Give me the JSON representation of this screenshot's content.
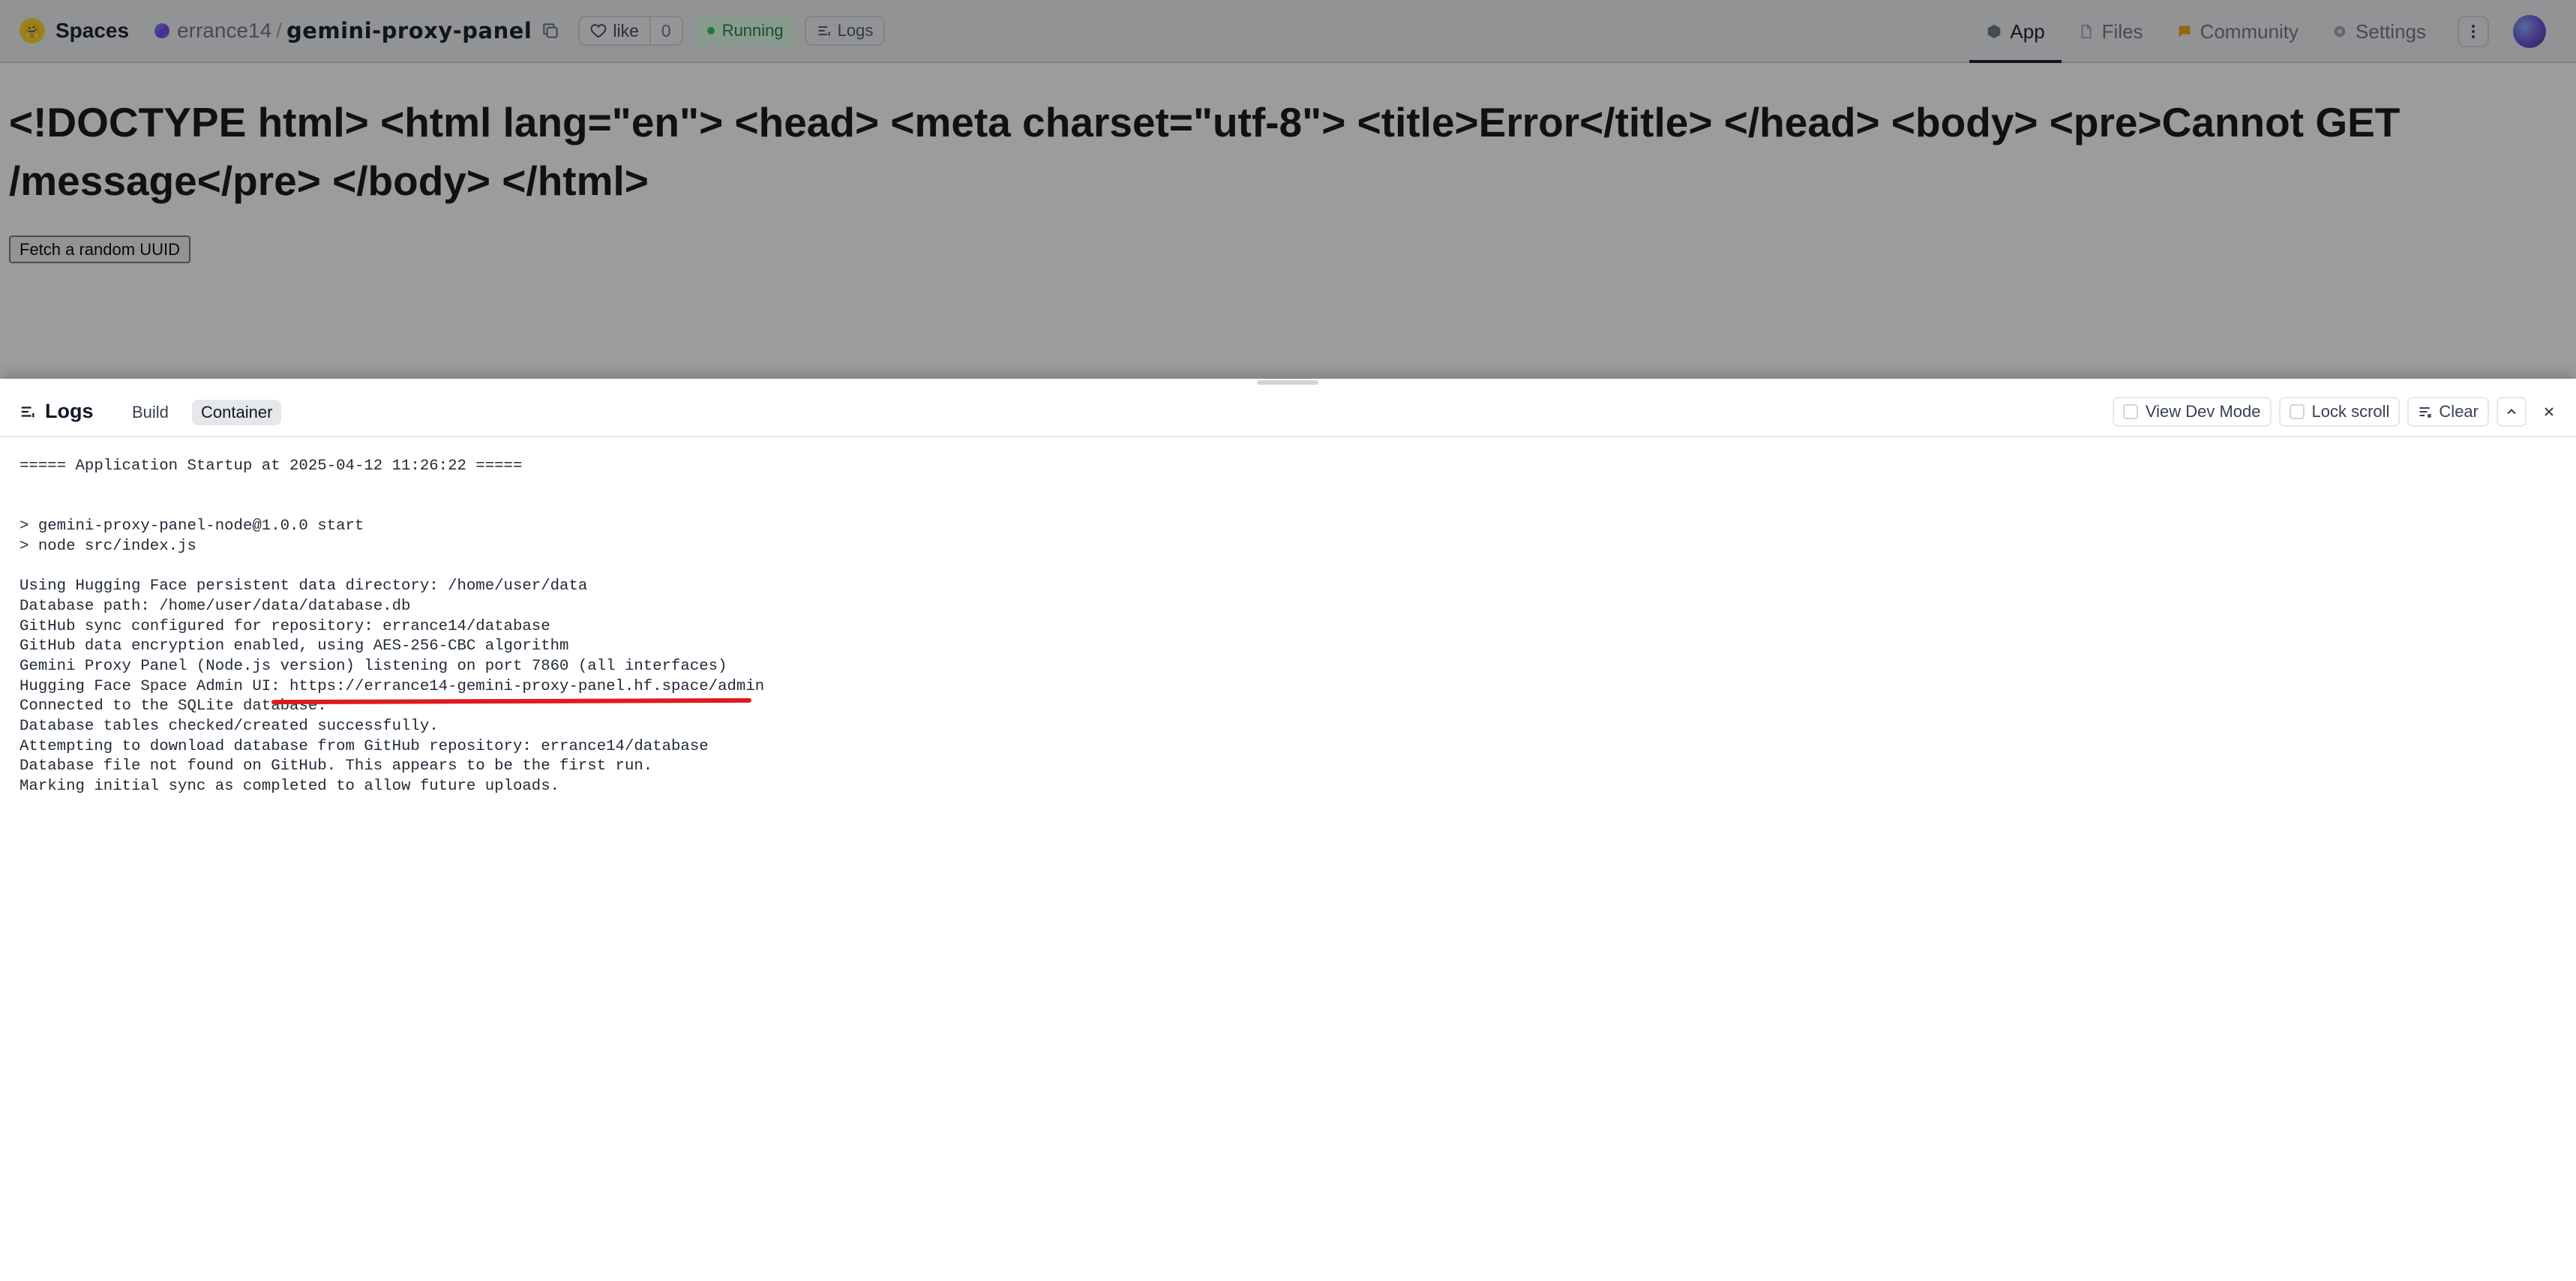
{
  "header": {
    "brand": "Spaces",
    "owner": "errance14",
    "separator": "/",
    "repo": "gemini-proxy-panel",
    "like_label": "like",
    "like_count": "0",
    "status": "Running",
    "logs_label": "Logs",
    "nav": [
      {
        "label": "App",
        "icon": "cube-icon",
        "active": true
      },
      {
        "label": "Files",
        "icon": "files-icon",
        "active": false
      },
      {
        "label": "Community",
        "icon": "community-icon",
        "active": false
      },
      {
        "label": "Settings",
        "icon": "gear-icon",
        "active": false
      }
    ]
  },
  "app": {
    "error_text": "<!DOCTYPE html> <html lang=\"en\"> <head> <meta charset=\"utf-8\"> <title>Error</title> </head> <body> <pre>Cannot GET /message</pre> </body> </html>",
    "fetch_button": "Fetch a random UUID"
  },
  "logs_panel": {
    "title": "Logs",
    "tabs": [
      {
        "label": "Build",
        "active": false
      },
      {
        "label": "Container",
        "active": true
      }
    ],
    "view_dev_mode": "View Dev Mode",
    "lock_scroll": "Lock scroll",
    "clear": "Clear",
    "lines": [
      "===== Application Startup at 2025-04-12 11:26:22 =====",
      "",
      "",
      "> gemini-proxy-panel-node@1.0.0 start",
      "> node src/index.js",
      "",
      "Using Hugging Face persistent data directory: /home/user/data",
      "Database path: /home/user/data/database.db",
      "GitHub sync configured for repository: errance14/database",
      "GitHub data encryption enabled, using AES-256-CBC algorithm",
      "Gemini Proxy Panel (Node.js version) listening on port 7860 (all interfaces)",
      "Hugging Face Space Admin UI: https://errance14-gemini-proxy-panel.hf.space/admin",
      "Connected to the SQLite database.",
      "Database tables checked/created successfully.",
      "Attempting to download database from GitHub repository: errance14/database",
      "Database file not found on GitHub. This appears to be the first run.",
      "Marking initial sync as completed to allow future uploads."
    ]
  },
  "colors": {
    "status_green": "#15803d",
    "annotation_red": "#e0191c"
  }
}
